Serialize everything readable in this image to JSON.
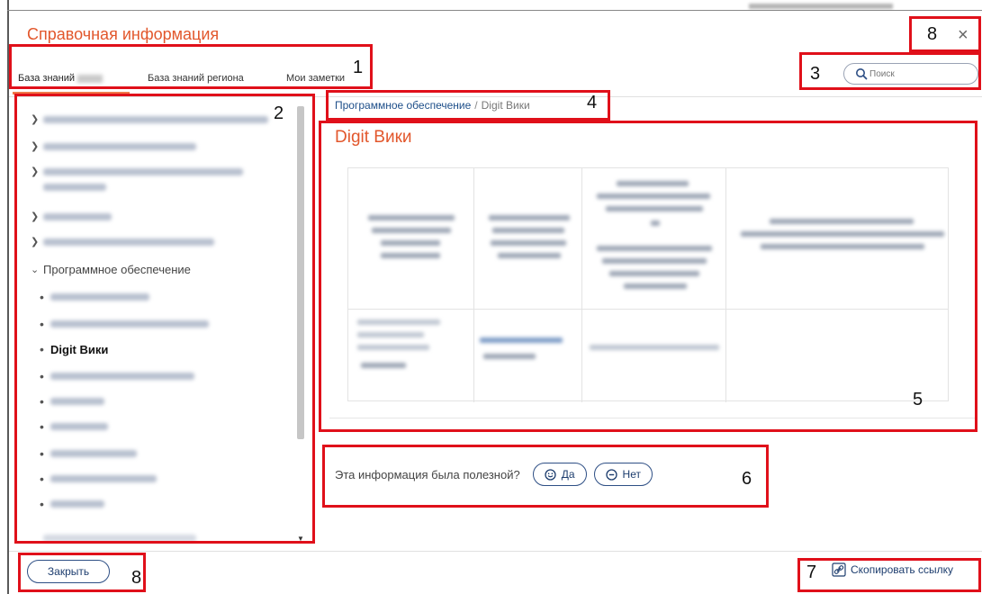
{
  "dialog": {
    "title": "Справочная информация",
    "close_glyph": "×"
  },
  "tabs": [
    {
      "label": "База знаний",
      "active": true
    },
    {
      "label": "База знаний региона",
      "active": false
    },
    {
      "label": "Мои заметки",
      "active": false
    }
  ],
  "search": {
    "placeholder": "Поиск",
    "icon": "search-icon"
  },
  "sidebar": {
    "expanded_label": "Программное обеспечение",
    "current_label": "Digit Вики"
  },
  "breadcrumb": {
    "parent": "Программное обеспечение",
    "separator": "/",
    "current": "Digit Вики"
  },
  "article": {
    "title": "Digit Вики"
  },
  "feedback": {
    "question": "Эта информация была полезной?",
    "yes_label": "Да",
    "no_label": "Нет"
  },
  "footer": {
    "close_label": "Закрыть",
    "copy_link_label": "Скопировать ссылку"
  },
  "annotations": [
    "1",
    "2",
    "3",
    "4",
    "5",
    "6",
    "7",
    "8",
    "8"
  ],
  "colors": {
    "accent": "#e2572c",
    "link": "#1d4e89",
    "button_border": "#2e4f85",
    "annotation": "#e0101a"
  }
}
